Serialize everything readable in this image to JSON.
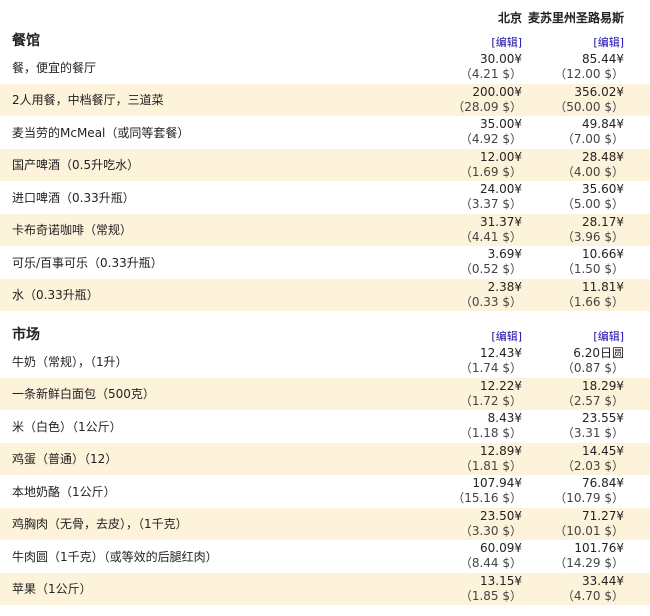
{
  "columns": {
    "city1": "北京",
    "city2": "麦苏里州圣路易斯"
  },
  "sections": [
    {
      "title": "餐馆",
      "edit1": "[编辑]",
      "edit2": "[编辑]",
      "items": [
        {
          "name": "餐，便宜的餐厅",
          "v1": "30.00¥",
          "s1": "（4.21 $）",
          "v2": "85.44¥",
          "s2": "（12.00 $）"
        },
        {
          "name": "2人用餐，中档餐厅，三道菜",
          "v1": "200.00¥",
          "s1": "（28.09 $）",
          "v2": "356.02¥",
          "s2": "（50.00 $）"
        },
        {
          "name": "麦当劳的McMeal（或同等套餐）",
          "v1": "35.00¥",
          "s1": "（4.92 $）",
          "v2": "49.84¥",
          "s2": "（7.00 $）"
        },
        {
          "name": "国产啤酒（0.5升吃水）",
          "v1": "12.00¥",
          "s1": "（1.69 $）",
          "v2": "28.48¥",
          "s2": "（4.00 $）"
        },
        {
          "name": "进口啤酒（0.33升瓶）",
          "v1": "24.00¥",
          "s1": "（3.37 $）",
          "v2": "35.60¥",
          "s2": "（5.00 $）"
        },
        {
          "name": "卡布奇诺咖啡（常规）",
          "v1": "31.37¥",
          "s1": "（4.41 $）",
          "v2": "28.17¥",
          "s2": "（3.96 $）"
        },
        {
          "name": "可乐/百事可乐（0.33升瓶）",
          "v1": "3.69¥",
          "s1": "（0.52 $）",
          "v2": "10.66¥",
          "s2": "（1.50 $）"
        },
        {
          "name": "水（0.33升瓶）",
          "v1": "2.38¥",
          "s1": "（0.33 $）",
          "v2": "11.81¥",
          "s2": "（1.66 $）"
        }
      ]
    },
    {
      "title": "市场",
      "edit1": "[编辑]",
      "edit2": "[编辑]",
      "items": [
        {
          "name": "牛奶（常规），（1升）",
          "v1": "12.43¥",
          "s1": "（1.74 $）",
          "v2": "6.20日圆",
          "s2": "（0.87 $）"
        },
        {
          "name": "一条新鲜白面包（500克）",
          "v1": "12.22¥",
          "s1": "（1.72 $）",
          "v2": "18.29¥",
          "s2": "（2.57 $）"
        },
        {
          "name": "米（白色）（1公斤）",
          "v1": "8.43¥",
          "s1": "（1.18 $）",
          "v2": "23.55¥",
          "s2": "（3.31 $）"
        },
        {
          "name": "鸡蛋（普通）（12）",
          "v1": "12.89¥",
          "s1": "（1.81 $）",
          "v2": "14.45¥",
          "s2": "（2.03 $）"
        },
        {
          "name": "本地奶酪（1公斤）",
          "v1": "107.94¥",
          "s1": "（15.16 $）",
          "v2": "76.84¥",
          "s2": "（10.79 $）"
        },
        {
          "name": "鸡胸肉（无骨，去皮），（1千克）",
          "v1": "23.50¥",
          "s1": "（3.30 $）",
          "v2": "71.27¥",
          "s2": "（10.01 $）"
        },
        {
          "name": "牛肉圆（1千克）（或等效的后腿红肉）",
          "v1": "60.09¥",
          "s1": "（8.44 $）",
          "v2": "101.76¥",
          "s2": "（14.29 $）"
        },
        {
          "name": "苹果（1公斤）",
          "v1": "13.15¥",
          "s1": "（1.85 $）",
          "v2": "33.44¥",
          "s2": "（4.70 $）"
        }
      ]
    }
  ]
}
